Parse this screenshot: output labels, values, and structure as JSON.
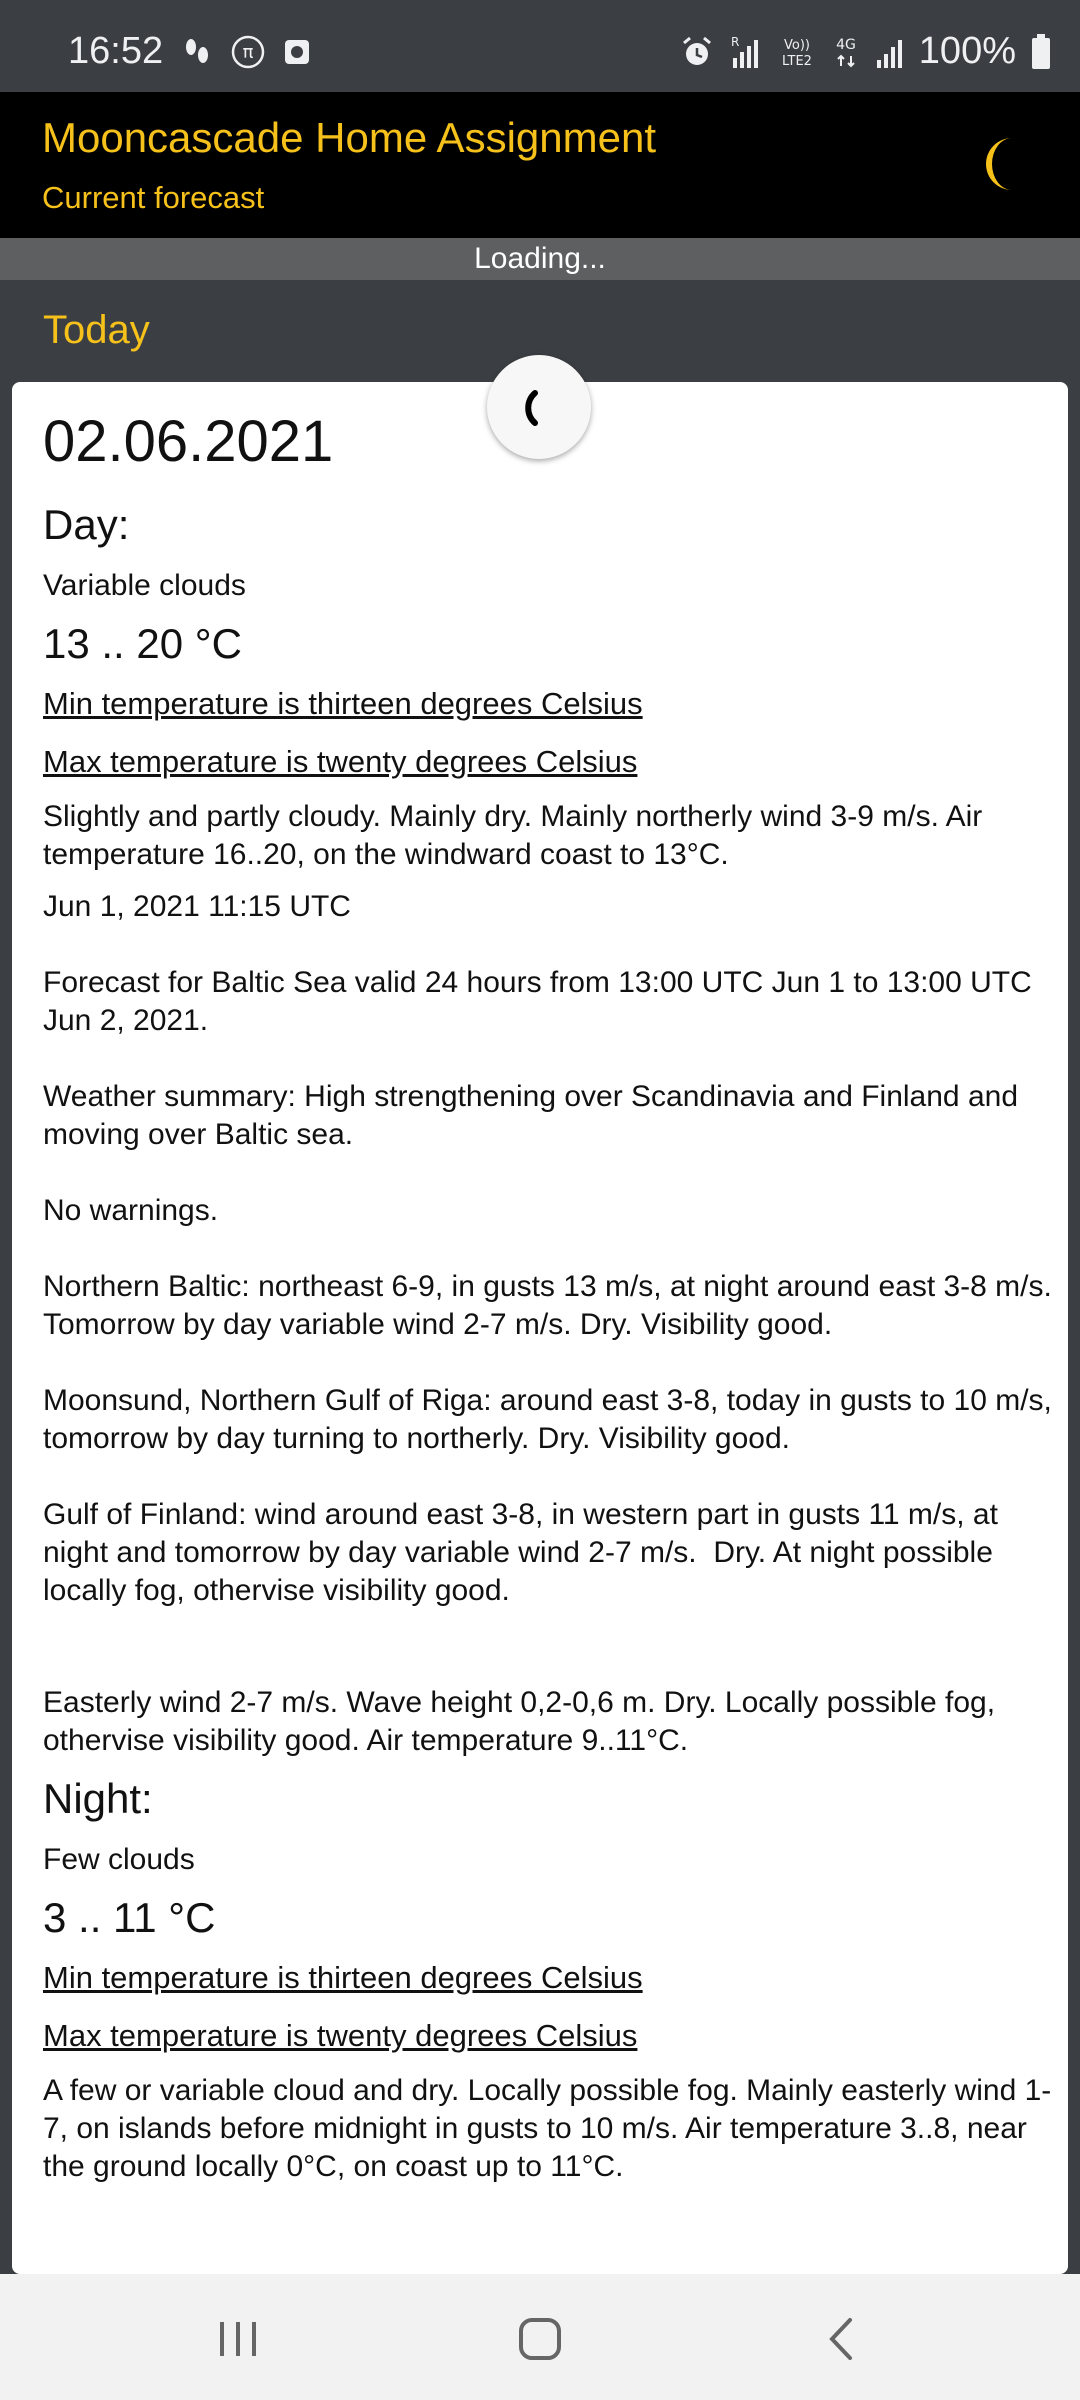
{
  "status_bar": {
    "time": "16:52",
    "battery": "100%",
    "icons_left": [
      "steps-icon",
      "pi-icon",
      "screen-record-icon"
    ],
    "icons_right": [
      "alarm-icon",
      "signal-r-icon",
      "volte-icon",
      "4g-icon",
      "signal-icon",
      "battery-icon"
    ],
    "network": "4G",
    "volte": "Vo)) LTE2"
  },
  "app_bar": {
    "title": "Mooncascade Home Assignment",
    "subtitle": "Current forecast",
    "accent_color": "#f6c11a",
    "theme_icon": "moon-icon"
  },
  "loading_bar": {
    "text": "Loading..."
  },
  "section": {
    "title": "Today"
  },
  "forecast": {
    "date": "02.06.2021",
    "day": {
      "label": "Day:",
      "phenomenon": "Variable clouds",
      "temp_range": "13 .. 20 °C",
      "min_link": "Min temperature is thirteen degrees Celsius",
      "max_link": "Max temperature is twenty degrees Celsius",
      "text": "Slightly and partly cloudy. Mainly dry. Mainly northerly wind 3-9 m/s. Air temperature 16..20, on the windward coast to 13°C.",
      "sea": "Jun 1, 2021 11:15 UTC\n\nForecast for Baltic Sea valid 24 hours from 13:00 UTC Jun 1 to 13:00 UTC Jun 2, 2021.\n\nWeather summary: High strengthening over Scandinavia and Finland and moving over Baltic sea.\n\nNo warnings.\n\nNorthern Baltic: northeast 6-9, in gusts 13 m/s, at night around east 3-8 m/s. Tomorrow by day variable wind 2-7 m/s. Dry. Visibility good.\n\nMoonsund, Northern Gulf of Riga: around east 3-8, today in gusts to 10 m/s, tomorrow by day turning to northerly. Dry. Visibility good.\n\nGulf of Finland: wind around east 3-8, in western part in gusts 11 m/s, at night and tomorrow by day variable wind 2-7 m/s.  Dry. At night possible locally fog, othervise visibility good.",
      "peipsi": "Easterly wind 2-7 m/s. Wave height 0,2-0,6 m. Dry. Locally possible fog, othervise visibility good. Air temperature 9..11°C."
    },
    "night": {
      "label": "Night:",
      "phenomenon": "Few clouds",
      "temp_range": "3 .. 11 °C",
      "min_link": "Min temperature is thirteen degrees Celsius",
      "max_link": "Max temperature is twenty degrees Celsius",
      "text": "A few or variable cloud and dry. Locally possible fog. Mainly easterly wind 1-7, on islands before midnight in gusts to 10 m/s. Air temperature 3..8, near the ground locally 0°C, on coast up to 11°C."
    }
  },
  "nav_bar": {
    "buttons": [
      "recent-apps-icon",
      "home-icon",
      "back-icon"
    ]
  }
}
